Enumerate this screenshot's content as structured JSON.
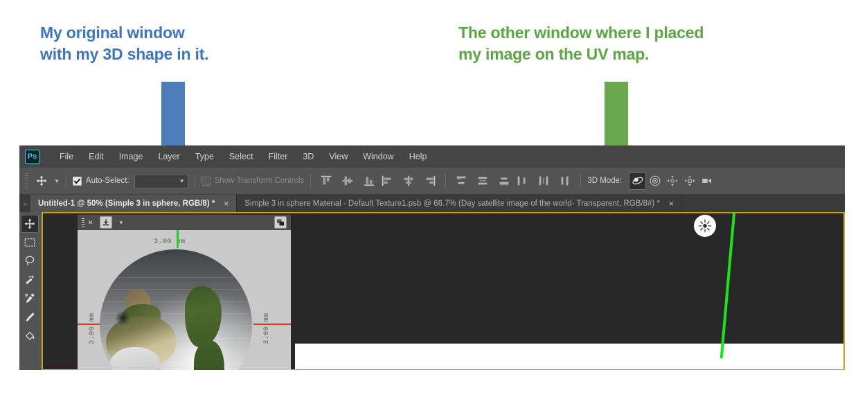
{
  "annotations": {
    "blue": {
      "line1": "My original window",
      "line2": "with my 3D shape in it.",
      "color": "#3f75c0",
      "arrow_name": "blue-down-arrow"
    },
    "green": {
      "line1": "The other window where I placed",
      "line2": "my image on the UV map.",
      "color": "#5ca543",
      "arrow_name": "green-down-arrow"
    }
  },
  "app": {
    "name": "Adobe Photoshop",
    "logo_text": "Ps",
    "logo_accent": "#2ad2f7",
    "menu": [
      {
        "label": "File"
      },
      {
        "label": "Edit"
      },
      {
        "label": "Image"
      },
      {
        "label": "Layer"
      },
      {
        "label": "Type"
      },
      {
        "label": "Select"
      },
      {
        "label": "Filter"
      },
      {
        "label": "3D"
      },
      {
        "label": "View"
      },
      {
        "label": "Window"
      },
      {
        "label": "Help"
      }
    ]
  },
  "options_bar": {
    "tool_icon": "move-tool-icon",
    "tool_preset_chevron": "chevron-down-icon",
    "auto_select": {
      "label": "Auto-Select:",
      "checked": true,
      "dropdown_value": ""
    },
    "show_transform_controls": {
      "label": "Show Transform Controls",
      "checked": false
    },
    "align_group_1": [
      "align-top-edges-icon",
      "align-vertical-centers-icon",
      "align-bottom-edges-icon",
      "align-left-edges-icon",
      "align-horizontal-centers-icon",
      "align-right-edges-icon"
    ],
    "align_group_2": [
      "distribute-top-edges-icon",
      "distribute-vertical-centers-icon",
      "distribute-bottom-edges-icon",
      "distribute-left-edges-icon",
      "distribute-horizontal-centers-icon",
      "distribute-right-edges-icon"
    ],
    "mode3d": {
      "label": "3D Mode:",
      "buttons": [
        {
          "name": "rotate-3d-object-icon",
          "active": true
        },
        {
          "name": "roll-3d-object-icon",
          "active": false
        },
        {
          "name": "pan-3d-object-icon",
          "active": false
        },
        {
          "name": "slide-3d-object-icon",
          "active": false
        },
        {
          "name": "scale-3d-object-icon",
          "active": false
        }
      ]
    }
  },
  "tabs": [
    {
      "title": "Untitled-1 @ 50% (Simple 3 in sphere, RGB/8) *",
      "active": true,
      "close": "×"
    },
    {
      "title": "Simple 3 in sphere Material - Default Texture1.psb @  66.7% (Day satellite image of the world- Transparent, RGB/8#) *",
      "active": false,
      "close": "×"
    }
  ],
  "tools": [
    {
      "name": "move-tool-icon",
      "active": true
    },
    {
      "name": "rectangular-marquee-tool-icon",
      "active": false
    },
    {
      "name": "lasso-tool-icon",
      "active": false
    },
    {
      "name": "magic-wand-tool-icon",
      "active": false
    },
    {
      "name": "eyedropper-tool-icon",
      "active": false
    },
    {
      "name": "brush-tool-icon",
      "active": false
    },
    {
      "name": "paint-bucket-tool-icon",
      "active": false
    }
  ],
  "document_window": {
    "header_icons": [
      "panel-grip-icon",
      "close-icon",
      "import-icon",
      "chevron-down-icon",
      "screen-mode-icon"
    ],
    "close_glyph": "×",
    "dimensions": {
      "top": "3.00 mm",
      "left": "3.00 mm",
      "right": "3.00 mm"
    },
    "axis_colors": {
      "vertical_green": "#19d419",
      "horizontal_red": "#e23a30"
    }
  },
  "canvas": {
    "light_widget_icon": "infinite-light-icon",
    "ground_line_color": "#19e619",
    "background": "#282828",
    "document_background": "#ffffff",
    "active_border": "#c8a617"
  }
}
